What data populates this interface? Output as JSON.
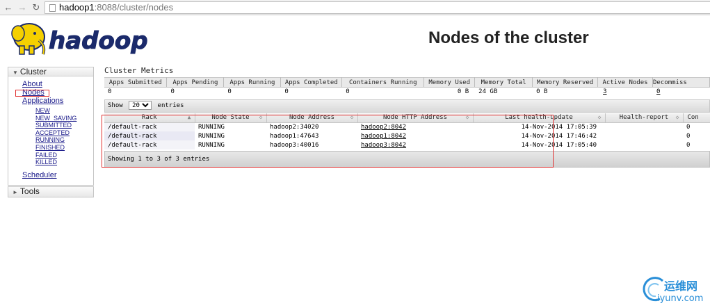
{
  "browser": {
    "url_host": "hadoop1",
    "url_path": ":8088/cluster/nodes"
  },
  "header": {
    "logo_text": "hadoop",
    "title": "Nodes of the cluster"
  },
  "sidebar": {
    "cluster_label": "Cluster",
    "about": "About",
    "nodes": "Nodes",
    "applications": "Applications",
    "app_states": [
      "NEW",
      "NEW_SAVING",
      "SUBMITTED",
      "ACCEPTED",
      "RUNNING",
      "FINISHED",
      "FAILED",
      "KILLED"
    ],
    "scheduler": "Scheduler",
    "tools_label": "Tools"
  },
  "metrics": {
    "title": "Cluster Metrics",
    "headers": [
      "Apps Submitted",
      "Apps Pending",
      "Apps Running",
      "Apps Completed",
      "Containers Running",
      "Memory Used",
      "Memory Total",
      "Memory Reserved",
      "Active Nodes",
      "Decommiss"
    ],
    "values": [
      "0",
      "0",
      "0",
      "0",
      "0",
      "0 B",
      "24 GB",
      "0 B",
      "3",
      "0"
    ]
  },
  "nodes_table": {
    "show_label": "Show",
    "page_size": "20",
    "entries_label": "entries",
    "headers": [
      "Rack",
      "Node State",
      "Node Address",
      "Node HTTP Address",
      "Last health-update",
      "Health-report",
      "Con"
    ],
    "rows": [
      [
        "/default-rack",
        "RUNNING",
        "hadoop2:34020",
        "hadoop2:8042",
        "14-Nov-2014 17:05:39",
        "",
        "0"
      ],
      [
        "/default-rack",
        "RUNNING",
        "hadoop1:47643",
        "hadoop1:8042",
        "14-Nov-2014 17:46:42",
        "",
        "0"
      ],
      [
        "/default-rack",
        "RUNNING",
        "hadoop3:40016",
        "hadoop3:8042",
        "14-Nov-2014 17:05:40",
        "",
        "0"
      ]
    ],
    "info": "Showing 1 to 3 of 3 entries"
  },
  "watermark": {
    "cn": "运维网",
    "en": "iyunv.com"
  },
  "colors": {
    "annotation_red": "#e03030",
    "logo_yellow": "#f5d000",
    "logo_navy": "#1b2a6b",
    "watermark_blue": "#2a8fd8"
  }
}
